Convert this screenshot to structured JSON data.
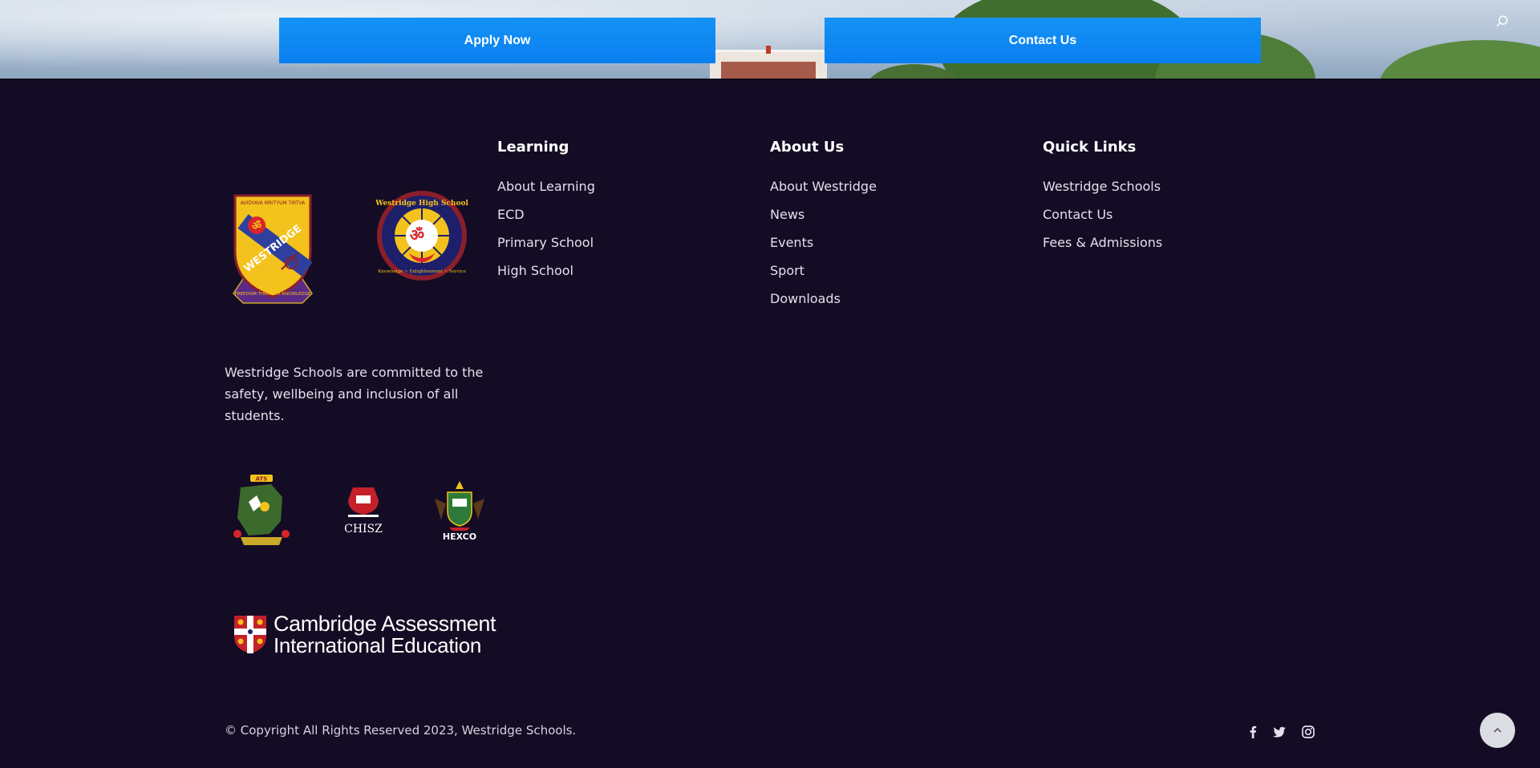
{
  "hero": {
    "apply_label": "Apply Now",
    "contact_label": "Contact Us"
  },
  "footer": {
    "columns": [
      {
        "title": "Learning",
        "links": [
          "About Learning",
          "ECD",
          "Primary School",
          "High School"
        ]
      },
      {
        "title": "About Us",
        "links": [
          "About Westridge",
          "News",
          "Events",
          "Sport",
          "Downloads"
        ]
      },
      {
        "title": "Quick Links",
        "links": [
          "Westridge Schools",
          "Contact Us",
          "Fees & Admissions"
        ]
      }
    ],
    "blurb": "Westridge Schools are committed to the safety, wellbeing and inclusion of all students.",
    "logos": {
      "westridge_crest_name": "WESTRIDGE",
      "westridge_crest_motto_top": "AVIDYAYA MRITYUM TIRTVA",
      "westridge_crest_motto_bottom": "FREEDOM THROUGH KNOWLEDGE",
      "high_school_seal_name": "Westridge High School",
      "high_school_seal_motto": "Knowledge ~ Enlightenment ~ Service",
      "ats_label": "ATS",
      "chisz_label": "CHISZ",
      "hexco_label": "HEXCO",
      "cambridge_line1": "Cambridge Assessment",
      "cambridge_line2": "International Education"
    },
    "copyright": "© Copyright All Rights Reserved 2023, Westridge Schools.",
    "social": [
      "facebook-icon",
      "twitter-icon",
      "instagram-icon"
    ]
  },
  "colors": {
    "footer_bg": "#140c24",
    "button_blue": "#0a7ff0",
    "text_white": "#ffffff"
  }
}
